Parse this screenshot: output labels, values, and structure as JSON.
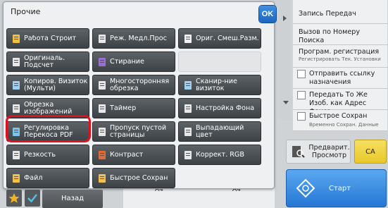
{
  "panel": {
    "title": "Прочие",
    "ok_label": "OK"
  },
  "functions": [
    {
      "label": "Работа Строит",
      "icon": "job-build-icon",
      "enabled": true
    },
    {
      "label": "Реж. Медл.Прос",
      "icon": "slow-scan-icon",
      "enabled": true
    },
    {
      "label": "Ориг. Смеш.Разм.",
      "icon": "mixed-size-original-icon",
      "enabled": true
    },
    {
      "label": "Оригиналь. Подсчет",
      "icon": "original-count-icon",
      "enabled": true
    },
    {
      "label": "Стирание",
      "icon": "erase-icon",
      "enabled": true
    },
    {
      "label": "",
      "icon": "",
      "enabled": false
    },
    {
      "label": "Копиров. Визиток (Мульти)",
      "icon": "business-card-copy-icon",
      "enabled": true
    },
    {
      "label": "Многосторонняя обрезка",
      "icon": "multi-crop-icon",
      "enabled": true
    },
    {
      "label": "Сканир-ние визиток",
      "icon": "business-card-scan-icon",
      "enabled": true
    },
    {
      "label": "Обрезка изображений",
      "icon": "image-crop-icon",
      "enabled": true
    },
    {
      "label": "Таймер",
      "icon": "timer-icon",
      "enabled": true
    },
    {
      "label": "Настройка Фона",
      "icon": "background-adjust-icon",
      "enabled": true
    },
    {
      "label": "Регулировка Перекоса PDF",
      "icon": "pdf-skew-adjust-icon",
      "enabled": true
    },
    {
      "label": "Пропуск пустой страницы",
      "icon": "blank-page-skip-icon",
      "enabled": true
    },
    {
      "label": "Выпадающий цвет",
      "icon": "color-dropout-icon",
      "enabled": true
    },
    {
      "label": "Резкость",
      "icon": "sharpness-icon",
      "enabled": true
    },
    {
      "label": "Контраст",
      "icon": "contrast-icon",
      "enabled": true
    },
    {
      "label": "Коррект. RGB",
      "icon": "rgb-adjust-icon",
      "enabled": true
    },
    {
      "label": "Файл",
      "icon": "file-folder-icon",
      "enabled": true
    },
    {
      "label": "Быстрое Сохран",
      "icon": "quick-save-icon",
      "enabled": true
    }
  ],
  "bottom_bar": {
    "back_label": "Назад"
  },
  "background": {
    "paper_a": "A4",
    "paper_b": "A4"
  },
  "right_panel": {
    "items": [
      {
        "label": "Запись Передач"
      },
      {
        "label": "Вызов по Номеру Поиска"
      },
      {
        "label": "Програм. регистрация",
        "sub": "Регистрировать Тек. Установки"
      }
    ],
    "checks": [
      {
        "label": "Отправить ссылку назначения"
      },
      {
        "label": "Передать То Же Изоб. как Адрес Факса"
      },
      {
        "label": "Быстрое Сохран",
        "sub": "Временно Сохран. Данные"
      }
    ],
    "preview_label": "Предварит. Просмотр",
    "ca_label": "CA",
    "start_label": "Старт"
  },
  "colors": {
    "accent_blue": "#2477d4",
    "highlight_red": "#e0101e",
    "ca_yellow": "#e8c82a"
  }
}
